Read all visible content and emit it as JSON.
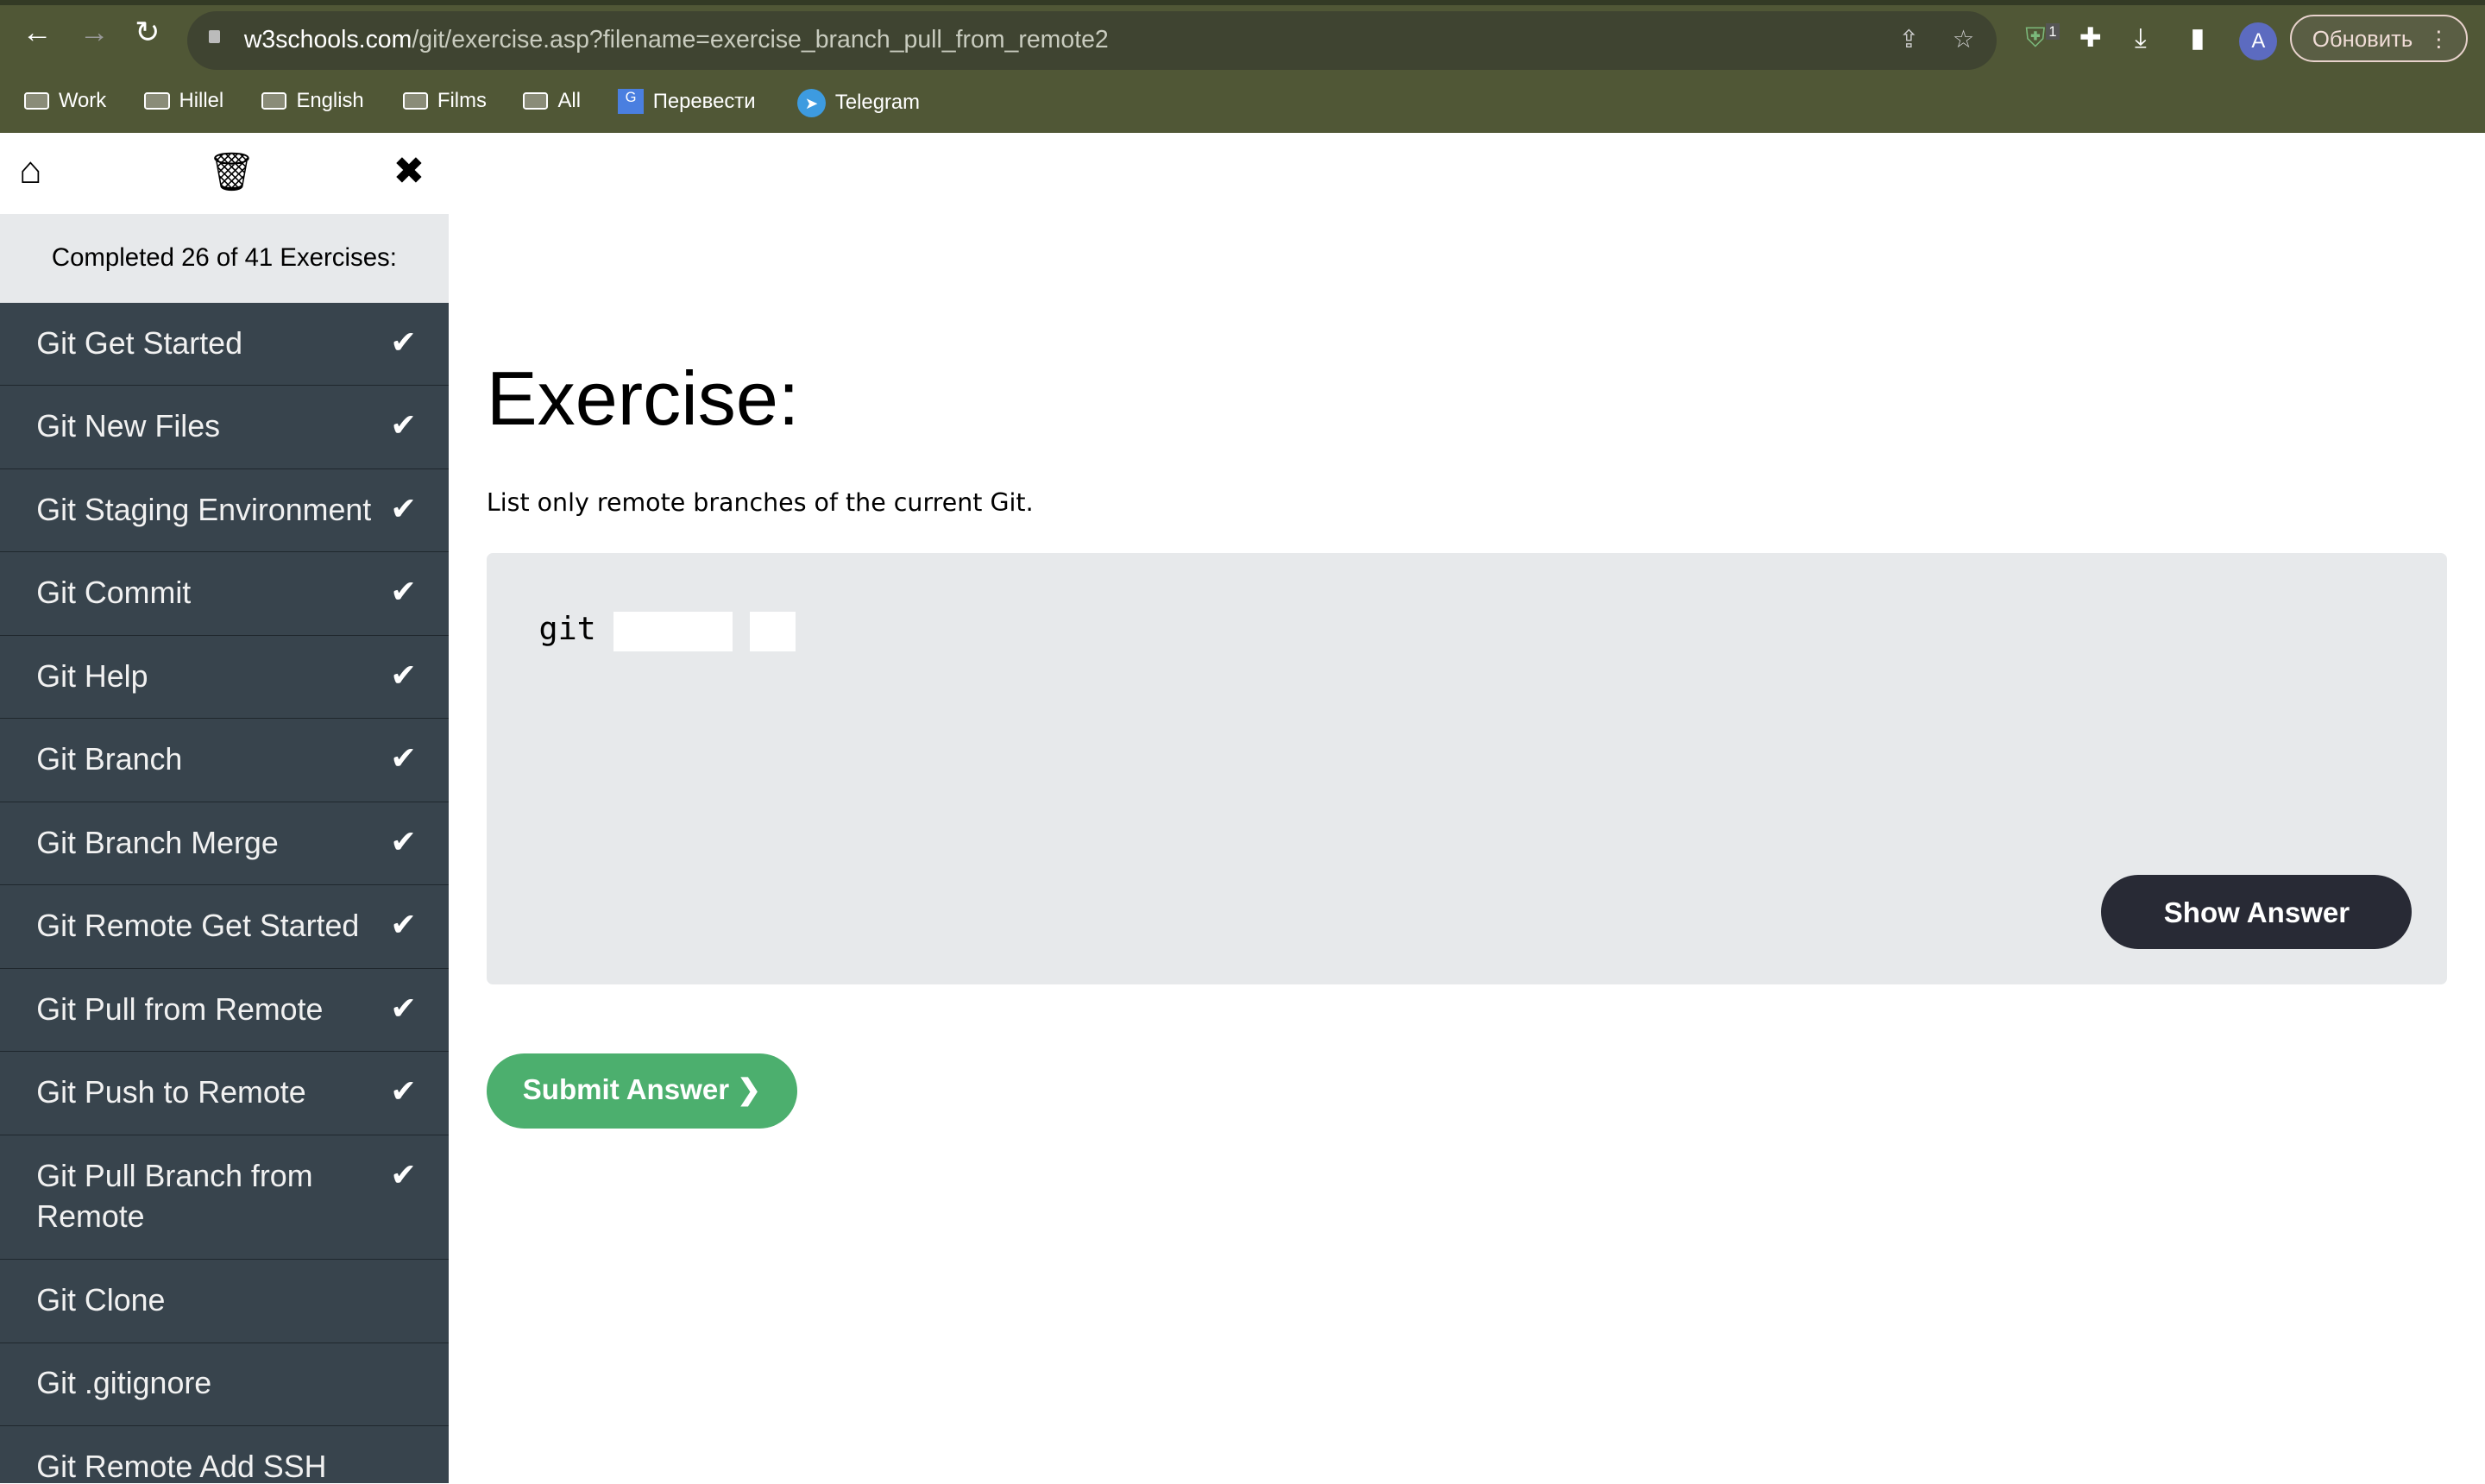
{
  "browser": {
    "url_domain": "w3schools.com",
    "url_path": "/git/exercise.asp?filename=exercise_branch_pull_from_remote2",
    "badge": "1",
    "avatar": "A",
    "update_label": "Обновить",
    "bookmarks": [
      "Work",
      "Hillel",
      "English",
      "Films",
      "All",
      "Перевести",
      "Telegram"
    ]
  },
  "sidebar": {
    "progress": "Completed 26 of 41 Exercises:",
    "completed": 26,
    "total": 41,
    "items": [
      {
        "label": "Git Get Started",
        "done": true
      },
      {
        "label": "Git New Files",
        "done": true
      },
      {
        "label": "Git Staging Environment",
        "done": true
      },
      {
        "label": "Git Commit",
        "done": true
      },
      {
        "label": "Git Help",
        "done": true
      },
      {
        "label": "Git Branch",
        "done": true
      },
      {
        "label": "Git Branch Merge",
        "done": true
      },
      {
        "label": "Git Remote Get Started",
        "done": true
      },
      {
        "label": "Git Pull from Remote",
        "done": true
      },
      {
        "label": "Git Push to Remote",
        "done": true
      },
      {
        "label": "Git Pull Branch from Remote",
        "done": true
      },
      {
        "label": "Git Clone",
        "done": false
      },
      {
        "label": "Git .gitignore",
        "done": false
      },
      {
        "label": "Git Remote Add SSH",
        "done": false
      }
    ]
  },
  "main": {
    "title": "Exercise:",
    "description": "List only remote branches of the current Git.",
    "code_prefix": "git",
    "input1": "",
    "input2": "",
    "show_answer": "Show Answer",
    "submit": "Submit Answer ❯"
  }
}
